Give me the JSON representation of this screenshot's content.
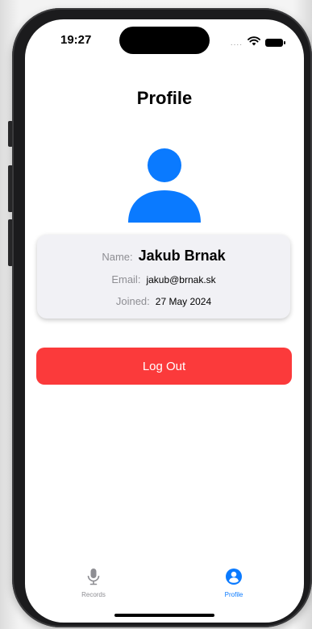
{
  "status_bar": {
    "time": "19:27",
    "signal": "....",
    "icons": [
      "wifi-icon",
      "battery-icon"
    ]
  },
  "page": {
    "title": "Profile"
  },
  "profile": {
    "name_label": "Name:",
    "name_value": "Jakub Brnak",
    "email_label": "Email:",
    "email_value": "jakub@brnak.sk",
    "joined_label": "Joined:",
    "joined_value": "27 May 2024"
  },
  "actions": {
    "logout_label": "Log Out"
  },
  "tab_bar": {
    "tabs": [
      {
        "label": "Records",
        "icon": "microphone-icon",
        "selected": false
      },
      {
        "label": "Profile",
        "icon": "person-circle-icon",
        "selected": true
      }
    ]
  },
  "colors": {
    "accent": "#0a7aff",
    "destructive": "#fb3a3b",
    "card_background": "#f1f1f5",
    "secondary_text": "#8e8e93"
  }
}
